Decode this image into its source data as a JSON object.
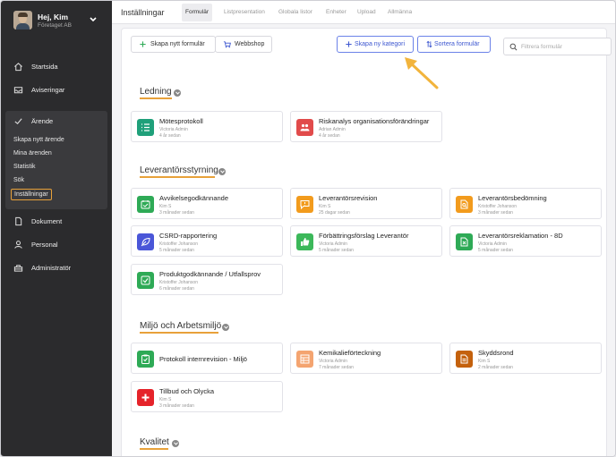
{
  "sidebar": {
    "user": {
      "name": "Hej, Kim",
      "company": "Företaget AB"
    },
    "items": [
      {
        "label": "Startsida",
        "icon": "home-icon"
      },
      {
        "label": "Aviseringar",
        "icon": "inbox-icon"
      },
      {
        "label": "Ärende",
        "icon": "check-icon"
      },
      {
        "label": "Dokument",
        "icon": "document-icon"
      },
      {
        "label": "Personal",
        "icon": "person-icon"
      },
      {
        "label": "Administratör",
        "icon": "admin-icon"
      }
    ],
    "subitems": [
      {
        "label": "Skapa nytt ärende"
      },
      {
        "label": "Mina ärenden"
      },
      {
        "label": "Statistik"
      },
      {
        "label": "Sök"
      },
      {
        "label": "Inställningar",
        "active": true
      }
    ]
  },
  "topbar": {
    "title": "Inställningar",
    "tabs": [
      {
        "label": "Formulär",
        "active": true
      },
      {
        "label": "Listpresentation"
      },
      {
        "label": "Globala listor"
      },
      {
        "label": "Enheter"
      },
      {
        "label": "Upload"
      },
      {
        "label": "Allmänna"
      }
    ]
  },
  "toolbar": {
    "create_form": "Skapa nytt formulär",
    "webshop": "Webbshop",
    "create_category": "Skapa ny kategori",
    "sort_forms": "Sortera formulär",
    "filter_placeholder": "Filtrera formulär"
  },
  "sections": [
    {
      "title": "Ledning",
      "cards": [
        {
          "title": "Mötesprotokoll",
          "author": "Victoria Admin",
          "date": "4 år sedan",
          "color": "#1fa07a",
          "icon": "list-icon"
        },
        {
          "title": "Riskanalys organisationsförändringar",
          "author": "Adrian Admin",
          "date": "4 år sedan",
          "color": "#e14b4b",
          "icon": "group-icon"
        }
      ]
    },
    {
      "title": "Leverantörsstyrning",
      "cards": [
        {
          "title": "Avvikelsegodkännande",
          "author": "Kim S",
          "date": "3 månader sedan",
          "color": "#2eaa56",
          "icon": "calendar-check-icon"
        },
        {
          "title": "Leverantörsrevision",
          "author": "Kim S",
          "date": "25 dagar sedan",
          "color": "#f29b1d",
          "icon": "chat-alert-icon"
        },
        {
          "title": "Leverantörsbedömning",
          "author": "Kristoffer Johanson",
          "date": "3 månader sedan",
          "color": "#f29b1d",
          "icon": "document-search-icon"
        },
        {
          "title": "CSRD-rapportering",
          "author": "Kristoffer Johanson",
          "date": "5 månader sedan",
          "color": "#4a56d8",
          "icon": "leaf-icon"
        },
        {
          "title": "Förbättringsförslag Leverantör",
          "author": "Victoria Admin",
          "date": "5 månader sedan",
          "color": "#3cb85a",
          "icon": "thumbs-up-icon"
        },
        {
          "title": "Leverantörsreklamation - 8D",
          "author": "Victoria Admin",
          "date": "5 månader sedan",
          "color": "#2eaa56",
          "icon": "document-x-icon"
        },
        {
          "title": "Produktgodkännande / Utfallsprov",
          "author": "Kristoffer Johanson",
          "date": "6 månader sedan",
          "color": "#2eaa56",
          "icon": "checkbox-icon"
        }
      ]
    },
    {
      "title": "Miljö och Arbetsmiljö",
      "cards": [
        {
          "title": "Protokoll internrevision - Miljö",
          "author": "",
          "date": "",
          "color": "#2eaa56",
          "icon": "clipboard-check-icon"
        },
        {
          "title": "Kemikalieförteckning",
          "author": "Victoria Admin",
          "date": "7 månader sedan",
          "color": "#f4a470",
          "icon": "table-icon"
        },
        {
          "title": "Skyddsrond",
          "author": "Kim S",
          "date": "2 månader sedan",
          "color": "#c4610d",
          "icon": "document-text-icon"
        },
        {
          "title": "Tillbud och Olycka",
          "author": "Kim S",
          "date": "3 månader sedan",
          "color": "#e5232a",
          "icon": "plus-icon"
        }
      ]
    },
    {
      "title": "Kvalitet",
      "cards": []
    }
  ]
}
